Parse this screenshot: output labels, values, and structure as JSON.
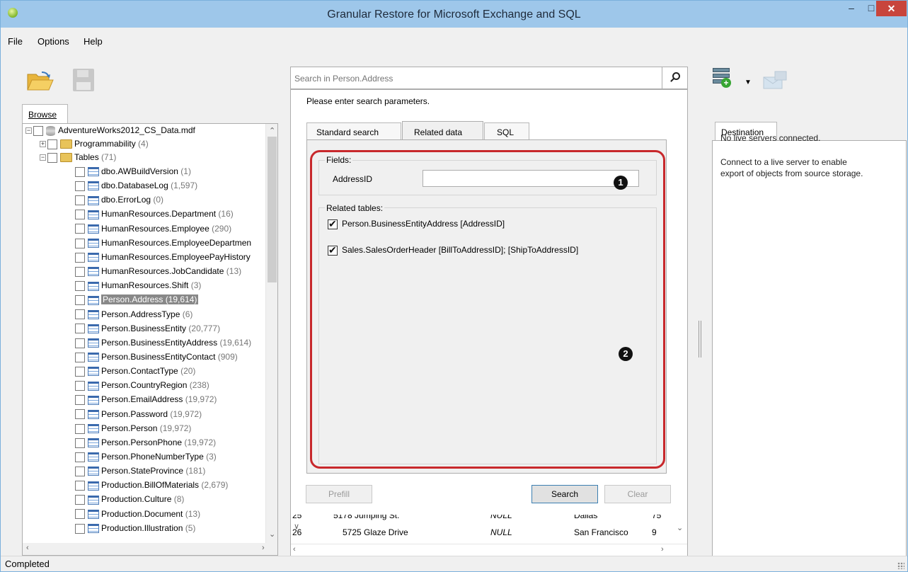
{
  "window": {
    "title": "Granular Restore for Microsoft Exchange and SQL",
    "min_label": "–",
    "max_label": "□",
    "close_label": "✕"
  },
  "menu": {
    "file": "File",
    "options": "Options",
    "help": "Help"
  },
  "left": {
    "tab_label": "Browse",
    "tree": {
      "root": "AdventureWorks2012_CS_Data.mdf",
      "programmability": {
        "label": "Programmability",
        "count": "(4)"
      },
      "tables": {
        "label": "Tables",
        "count": "(71)"
      },
      "items": [
        {
          "name": "dbo.AWBuildVersion",
          "count": "(1)"
        },
        {
          "name": "dbo.DatabaseLog",
          "count": "(1,597)"
        },
        {
          "name": "dbo.ErrorLog",
          "count": "(0)"
        },
        {
          "name": "HumanResources.Department",
          "count": "(16)"
        },
        {
          "name": "HumanResources.Employee",
          "count": "(290)"
        },
        {
          "name": "HumanResources.EmployeeDepartmen",
          "count": ""
        },
        {
          "name": "HumanResources.EmployeePayHistory",
          "count": ""
        },
        {
          "name": "HumanResources.JobCandidate",
          "count": "(13)"
        },
        {
          "name": "HumanResources.Shift",
          "count": "(3)"
        },
        {
          "name": "Person.Address (19,614)",
          "count": ""
        },
        {
          "name": "Person.AddressType",
          "count": "(6)"
        },
        {
          "name": "Person.BusinessEntity",
          "count": "(20,777)"
        },
        {
          "name": "Person.BusinessEntityAddress",
          "count": "(19,614)"
        },
        {
          "name": "Person.BusinessEntityContact",
          "count": "(909)"
        },
        {
          "name": "Person.ContactType",
          "count": "(20)"
        },
        {
          "name": "Person.CountryRegion",
          "count": "(238)"
        },
        {
          "name": "Person.EmailAddress",
          "count": "(19,972)"
        },
        {
          "name": "Person.Password",
          "count": "(19,972)"
        },
        {
          "name": "Person.Person",
          "count": "(19,972)"
        },
        {
          "name": "Person.PersonPhone",
          "count": "(19,972)"
        },
        {
          "name": "Person.PhoneNumberType",
          "count": "(3)"
        },
        {
          "name": "Person.StateProvince",
          "count": "(181)"
        },
        {
          "name": "Production.BillOfMaterials",
          "count": "(2,679)"
        },
        {
          "name": "Production.Culture",
          "count": "(8)"
        },
        {
          "name": "Production.Document",
          "count": "(13)"
        },
        {
          "name": "Production.Illustration",
          "count": "(5)"
        }
      ]
    }
  },
  "search": {
    "placeholder": "Search in Person.Address",
    "hint": "Please enter search parameters.",
    "tabs": [
      "Standard search",
      "Related data",
      "SQL"
    ],
    "fields_label": "Fields:",
    "address_id_label": "AddressID",
    "address_id_value": "",
    "related_label": "Related tables:",
    "related": [
      {
        "label": "Person.BusinessEntityAddress [AddressID]",
        "checked": true
      },
      {
        "label": "Sales.SalesOrderHeader [BillToAddressID]; [ShipToAddressID]",
        "checked": true
      }
    ],
    "badge1": "1",
    "badge2": "2",
    "prefill_label": "Prefill",
    "search_label": "Search",
    "clear_label": "Clear"
  },
  "grid": {
    "rows": [
      {
        "id": "25",
        "address": "5178 Jumping St.",
        "line2": "NULL",
        "city": "Dallas",
        "code": "75"
      },
      {
        "id": "26",
        "address": "5725 Glaze Drive",
        "line2": "NULL",
        "city": "San Francisco",
        "code": "9"
      }
    ]
  },
  "right": {
    "tab_label": "Destination",
    "line1": "No live servers connected.",
    "line2a": "Connect to a live server to enable",
    "line2b": "export of objects from source storage."
  },
  "status": {
    "text": "Completed"
  },
  "colors": {
    "titlebar": "#9ec7ea",
    "close": "#c8453c",
    "annotation": "#c8282c",
    "selection": "#888888"
  }
}
